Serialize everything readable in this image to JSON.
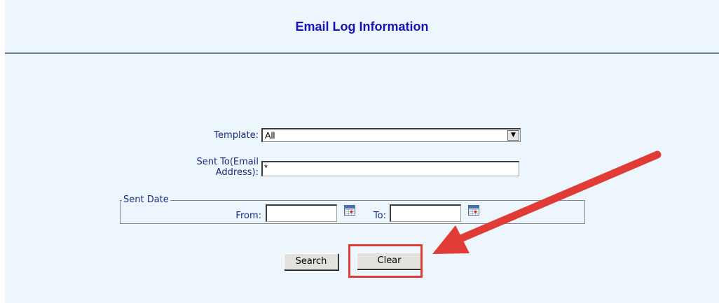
{
  "header": {
    "title": "Email Log Information"
  },
  "form": {
    "template_label": "Template:",
    "template_value": "All",
    "sent_to_label_line1": "Sent To(Email",
    "sent_to_label_line2": "Address):",
    "sent_to_value": "*",
    "sent_date_legend": "Sent Date",
    "from_label": "From:",
    "from_value": "",
    "to_label": "To:",
    "to_value": ""
  },
  "buttons": {
    "search": "Search",
    "clear": "Clear"
  },
  "annotation": {
    "color": "#e03c35",
    "arrow_icon": "red-arrow-icon"
  }
}
